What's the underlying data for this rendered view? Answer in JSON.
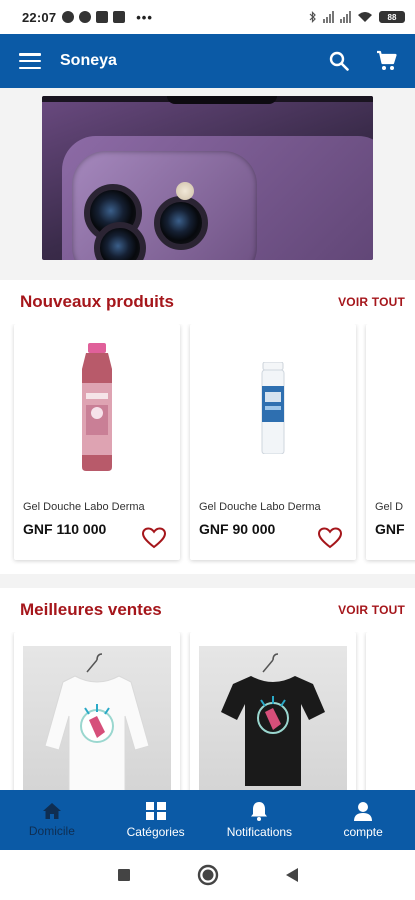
{
  "status_bar": {
    "time": "22:07",
    "battery": "88"
  },
  "app_bar": {
    "title": "Soneya",
    "icons": [
      "menu-icon",
      "search-icon",
      "cart-icon"
    ]
  },
  "colors": {
    "primary": "#0b5aa6",
    "accent_red": "#a5161b",
    "active_nav_label": "#0f2e52"
  },
  "sections": {
    "new_products": {
      "title": "Nouveaux produits",
      "see_all": "VOIR TOUT",
      "items": [
        {
          "name": "Gel Douche Labo Derma",
          "price": "GNF 110 000"
        },
        {
          "name": "Gel Douche Labo Derma",
          "price": "GNF 90 000"
        },
        {
          "name": "Gel D",
          "price": "GNF"
        }
      ]
    },
    "best_sellers": {
      "title": "Meilleures ventes",
      "see_all": "VOIR TOUT"
    }
  },
  "bottom_nav": {
    "items": [
      {
        "label": "Domicile",
        "icon": "home-icon",
        "active": true
      },
      {
        "label": "Catégories",
        "icon": "grid-icon",
        "active": false
      },
      {
        "label": "Notifications",
        "icon": "bell-icon",
        "active": false
      },
      {
        "label": "compte",
        "icon": "person-icon",
        "active": false
      }
    ]
  }
}
